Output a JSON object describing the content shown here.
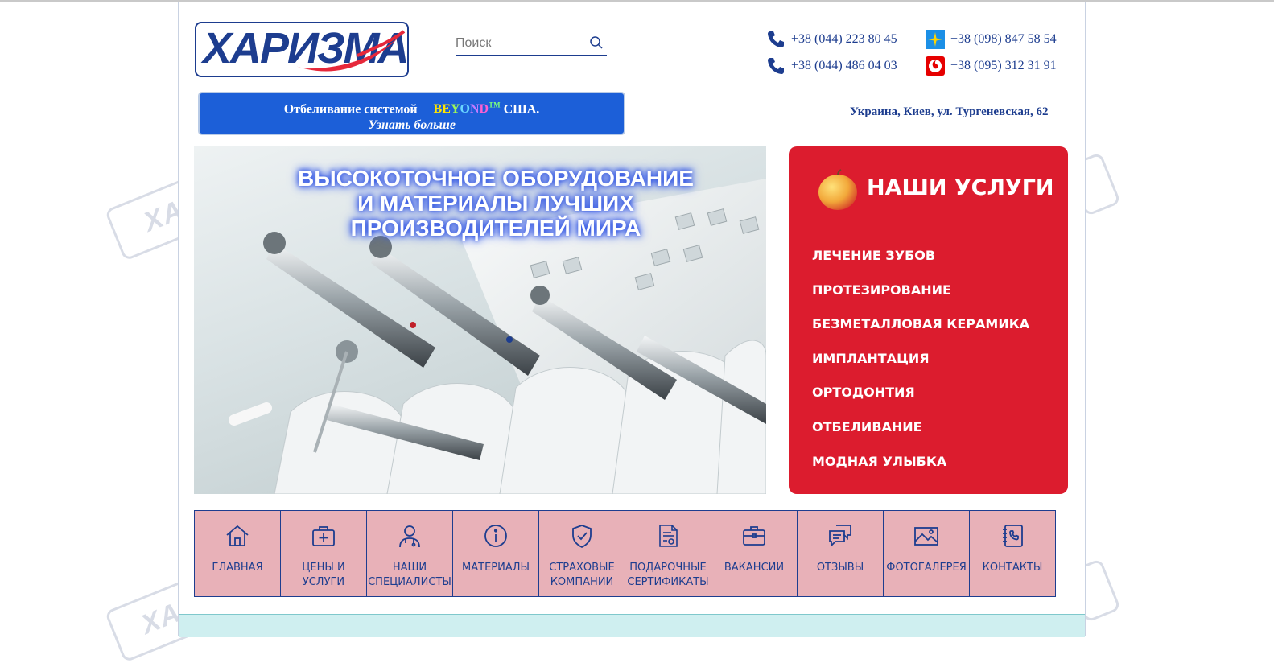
{
  "header": {
    "logo_text": "ХАРИЗМА",
    "search": {
      "placeholder": "Поиск"
    },
    "phones": [
      {
        "number": "+38 (044) 223 80 45",
        "icon": "phone-icon"
      },
      {
        "number": "+38 (098) 847 58 54",
        "icon": "kyivstar-icon"
      },
      {
        "number": "+38 (044) 486 04 03",
        "icon": "phone-icon"
      },
      {
        "number": "+38 (095) 312 31 91",
        "icon": "vodafone-icon"
      }
    ],
    "address": "Украина, Киев, ул. Тургеневская, 62"
  },
  "promo": {
    "line1_prefix": "Отбеливание системой",
    "brand_letters": [
      "B",
      "E",
      "Y",
      "O",
      "N",
      "D"
    ],
    "brand_tm": "TM",
    "line1_suffix": "США.",
    "line2": "Узнать больше"
  },
  "hero": {
    "title_lines": [
      "ВЫСОКОТОЧНОЕ ОБОРУДОВАНИЕ",
      "И МАТЕРИАЛЫ ЛУЧШИХ",
      "ПРОИЗВОДИТЕЛЕЙ МИРА"
    ]
  },
  "services": {
    "title": "НАШИ УСЛУГИ",
    "items": [
      "ЛЕЧЕНИЕ ЗУБОВ",
      "ПРОТЕЗИРОВАНИЕ",
      "БЕЗМЕТАЛЛОВАЯ КЕРАМИКА",
      "ИМПЛАНТАЦИЯ",
      "ОРТОДОНТИЯ",
      "ОТБЕЛИВАНИЕ",
      "МОДНАЯ УЛЫБКА"
    ]
  },
  "nav": [
    {
      "label": "ГЛАВНАЯ",
      "icon": "home-icon"
    },
    {
      "label": "ЦЕНЫ И\nУСЛУГИ",
      "icon": "first-aid-kit-icon"
    },
    {
      "label": "НАШИ\nСПЕЦИАЛИСТЫ",
      "icon": "doctor-icon"
    },
    {
      "label": "МАТЕРИАЛЫ",
      "icon": "info-icon"
    },
    {
      "label": "СТРАХОВЫЕ\nКОМПАНИИ",
      "icon": "shield-check-icon"
    },
    {
      "label": "ПОДАРОЧНЫЕ\nСЕРТИФИКАТЫ",
      "icon": "certificate-icon"
    },
    {
      "label": "ВАКАНСИИ",
      "icon": "briefcase-icon"
    },
    {
      "label": "ОТЗЫВЫ",
      "icon": "chat-icon"
    },
    {
      "label": "ФОТОГАЛЕРЕЯ",
      "icon": "image-icon"
    },
    {
      "label": "КОНТАКТЫ",
      "icon": "contacts-icon"
    }
  ],
  "colors": {
    "brand_blue": "#1d3d8f",
    "services_red": "#dc1c2e",
    "promo_blue": "#1c5fd8",
    "nav_pink": "#e8b1b8",
    "band_cyan": "#cfeff0"
  }
}
